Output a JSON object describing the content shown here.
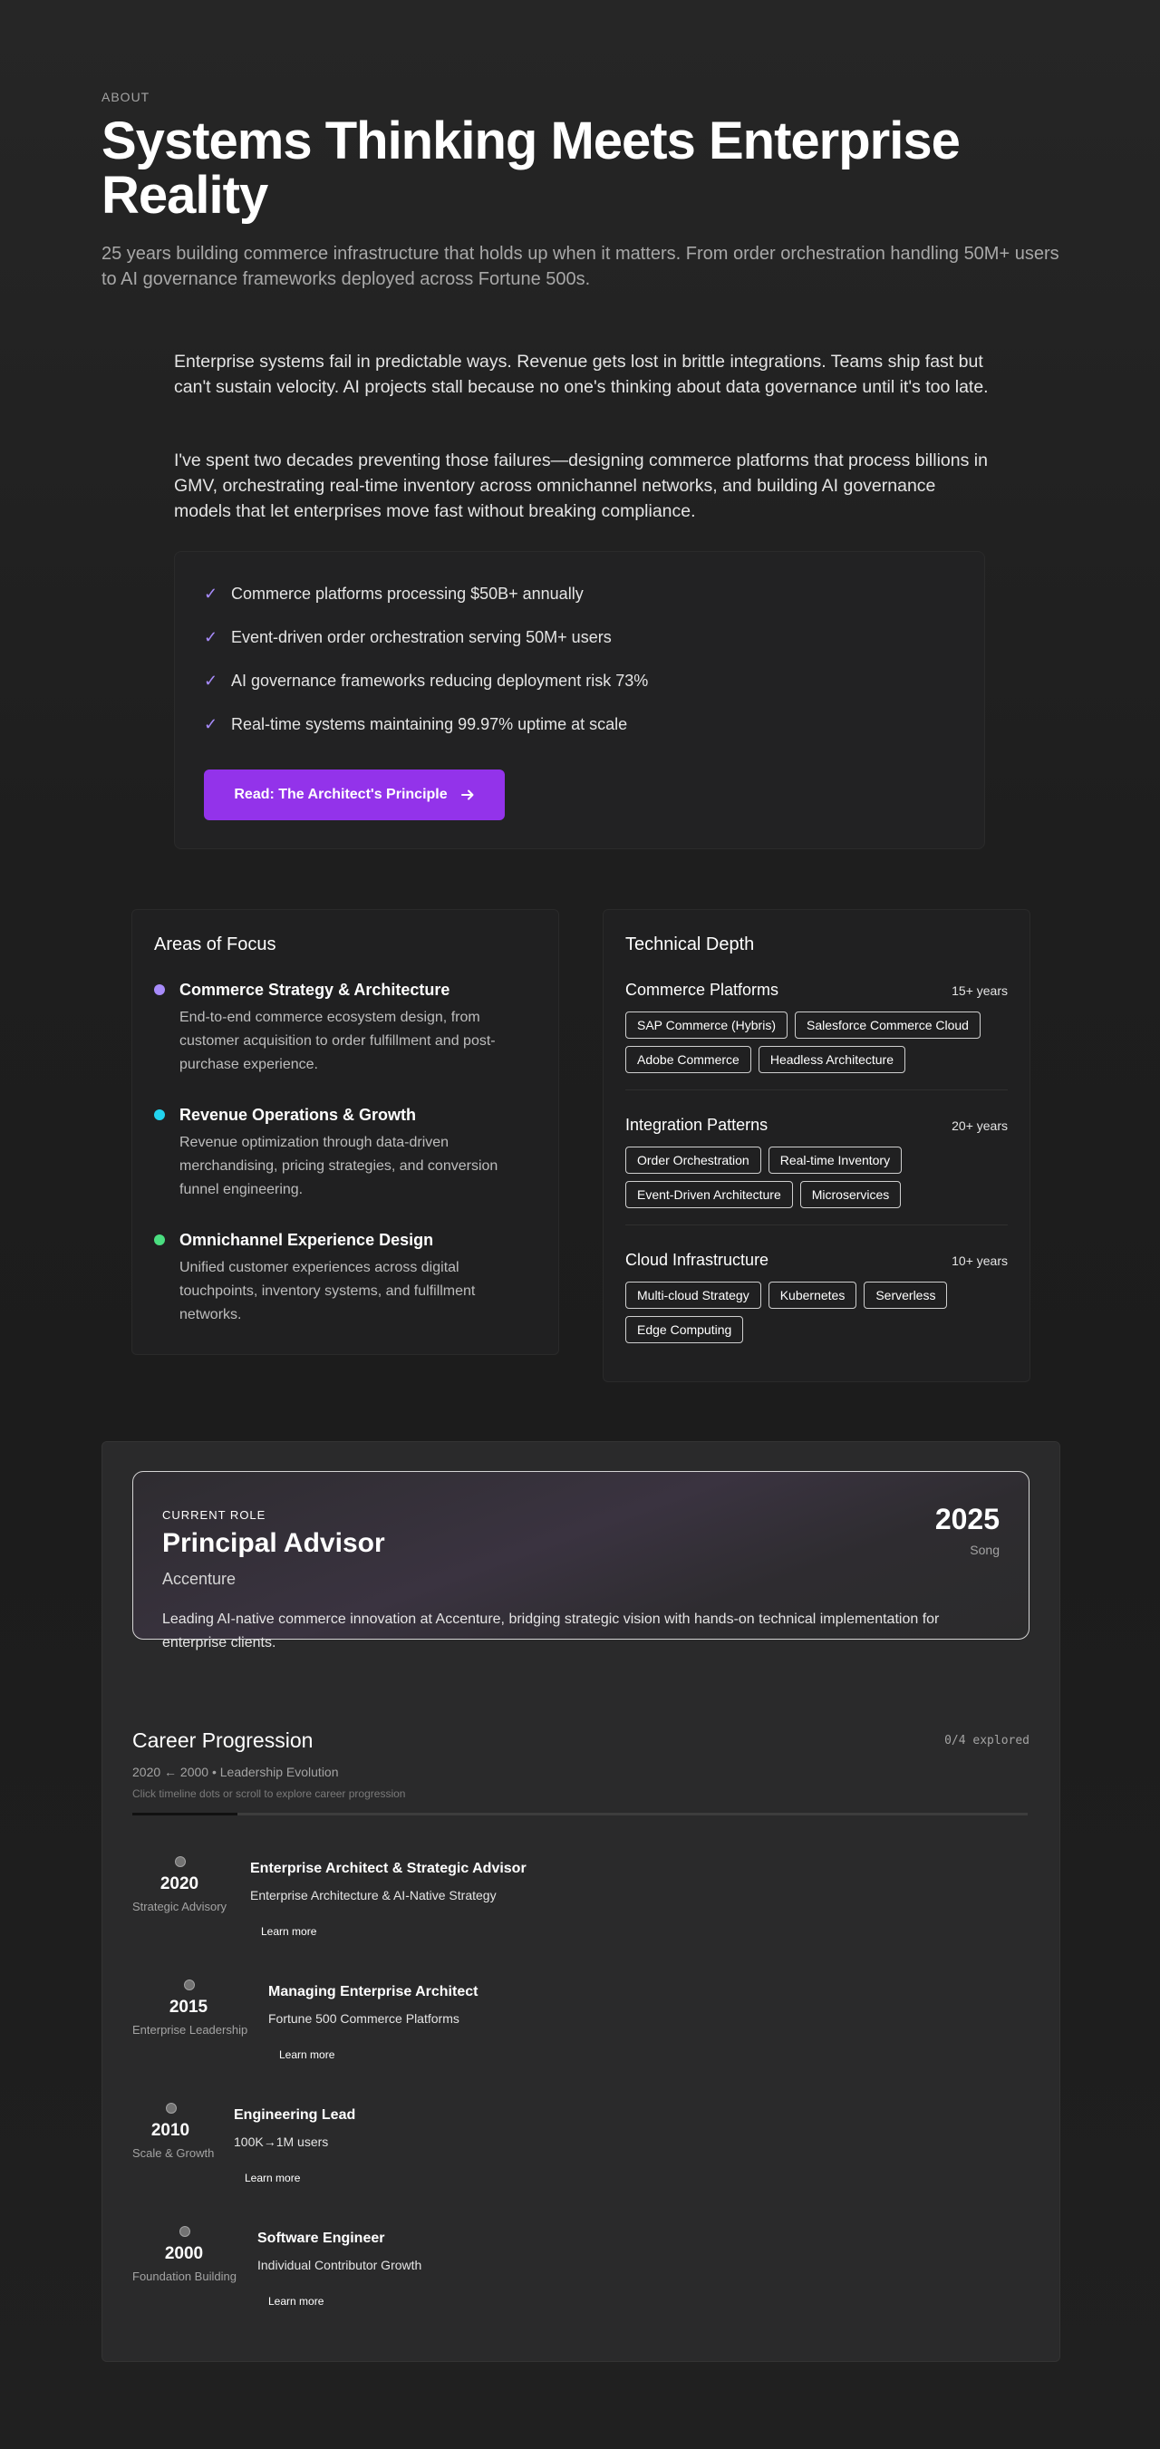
{
  "hero": {
    "eyebrow": "ABOUT",
    "title": "Systems Thinking Meets Enterprise Reality",
    "subtitle": "25 years building commerce infrastructure that holds up when it matters. From order orchestration handling 50M+ users to AI governance frameworks deployed across Fortune 500s."
  },
  "intro": {
    "p1": "Enterprise systems fail in predictable ways. Revenue gets lost in brittle integrations. Teams ship fast but can't sustain velocity. AI projects stall because no one's thinking about data governance until it's too late.",
    "p2": "I've spent two decades preventing those failures—designing commerce platforms that process billions in GMV, orchestrating real-time inventory across omnichannel networks, and building AI governance models that let enterprises move fast without breaking compliance."
  },
  "accomplishments": {
    "items": [
      "Commerce platforms processing $50B+ annually",
      "Event-driven order orchestration serving 50M+ users",
      "AI governance frameworks reducing deployment risk 73%",
      "Real-time systems maintaining 99.97% uptime at scale"
    ],
    "cta_label": "Read: The Architect's Principle",
    "cta_icon": "arrow-right-icon",
    "check_color": "#a78bfa",
    "cta_color": "#9333ea"
  },
  "focus": {
    "title": "Areas of Focus",
    "items": [
      {
        "name": "Commerce Strategy & Architecture",
        "desc": "End-to-end commerce ecosystem design, from customer acquisition to order fulfillment and post-purchase experience.",
        "color": "#a78bfa"
      },
      {
        "name": "Revenue Operations & Growth",
        "desc": "Revenue optimization through data-driven merchandising, pricing strategies, and conversion funnel engineering.",
        "color": "#22d3ee"
      },
      {
        "name": "Omnichannel Experience Design",
        "desc": "Unified customer experiences across digital touchpoints, inventory systems, and fulfillment networks.",
        "color": "#4ade80"
      }
    ]
  },
  "depth": {
    "title": "Technical Depth",
    "groups": [
      {
        "name": "Commerce Platforms",
        "years": "15+ years",
        "tags": [
          "SAP Commerce (Hybris)",
          "Salesforce Commerce Cloud",
          "Adobe Commerce",
          "Headless Architecture"
        ]
      },
      {
        "name": "Integration Patterns",
        "years": "20+ years",
        "tags": [
          "Order Orchestration",
          "Real-time Inventory",
          "Event-Driven Architecture",
          "Microservices"
        ]
      },
      {
        "name": "Cloud Infrastructure",
        "years": "10+ years",
        "tags": [
          "Multi-cloud Strategy",
          "Kubernetes",
          "Serverless",
          "Edge Computing"
        ]
      }
    ]
  },
  "current": {
    "eyebrow": "CURRENT ROLE",
    "title": "Principal Advisor",
    "company": "Accenture",
    "desc": "Leading AI-native commerce innovation at Accenture, bridging strategic vision with hands-on technical implementation for enterprise clients.",
    "year": "2025",
    "label": "Song"
  },
  "progression": {
    "title": "Career Progression",
    "explored": "0/4 explored",
    "subtitle": "2020 ← 2000 • Leadership Evolution",
    "hint": "Click timeline dots or scroll to explore career progression",
    "progress_fraction": 0,
    "items": [
      {
        "year": "2020",
        "label": "Strategic Advisory",
        "title": "Enterprise Architect & Strategic Advisor",
        "sub": "Enterprise Architecture & AI-Native Strategy",
        "more": "Learn more"
      },
      {
        "year": "2015",
        "label": "Enterprise Leadership",
        "title": "Managing Enterprise Architect",
        "sub": "Fortune 500 Commerce Platforms",
        "more": "Learn more"
      },
      {
        "year": "2010",
        "label": "Scale & Growth",
        "title": "Engineering Lead",
        "sub": "100K→1M users",
        "more": "Learn more"
      },
      {
        "year": "2000",
        "label": "Foundation Building",
        "title": "Software Engineer",
        "sub": "Individual Contributor Growth",
        "more": "Learn more"
      }
    ]
  }
}
